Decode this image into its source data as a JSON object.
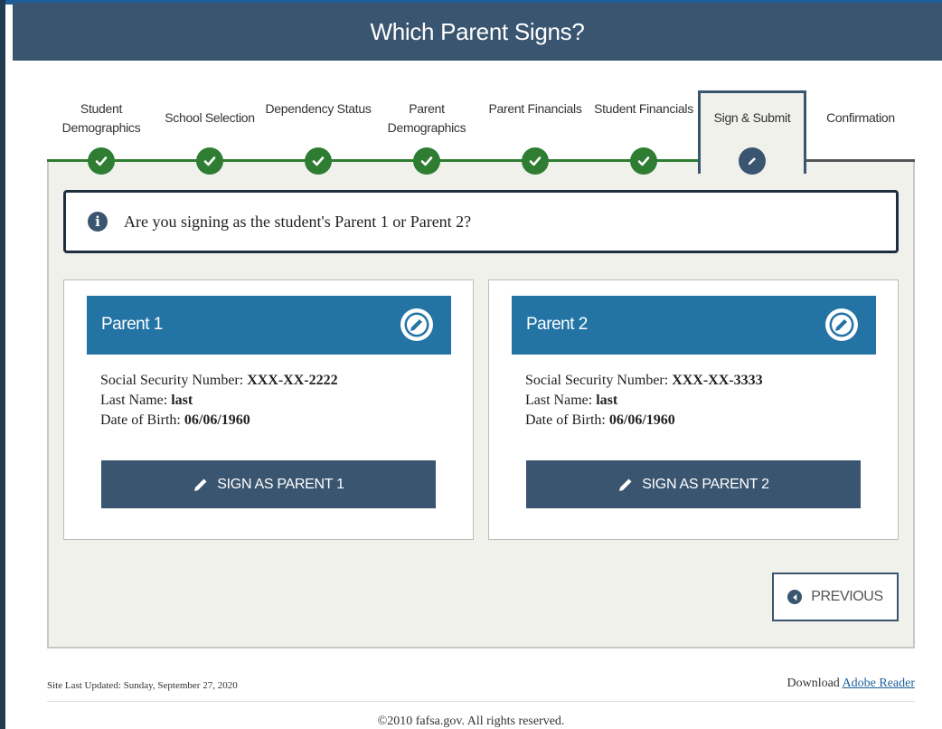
{
  "header": {
    "title": "Which Parent Signs?"
  },
  "steps": [
    {
      "label": "Student Demographics",
      "state": "complete"
    },
    {
      "label": "School Selection",
      "state": "complete"
    },
    {
      "label": "Dependency Status",
      "state": "complete"
    },
    {
      "label": "Parent Demographics",
      "state": "complete"
    },
    {
      "label": "Parent Financials",
      "state": "complete"
    },
    {
      "label": "Student Financials",
      "state": "complete"
    },
    {
      "label": "Sign & Submit",
      "state": "active"
    },
    {
      "label": "Confirmation",
      "state": "upcoming"
    }
  ],
  "info": {
    "text": "Are you signing as the student's Parent 1 or Parent 2?",
    "icon": "info-icon"
  },
  "parents": [
    {
      "title": "Parent 1",
      "ssn_label": "Social Security Number:",
      "ssn": "XXX-XX-2222",
      "lastname_label": "Last Name:",
      "lastname": "last",
      "dob_label": "Date of Birth:",
      "dob": "06/06/1960",
      "button": "SIGN AS PARENT 1"
    },
    {
      "title": "Parent 2",
      "ssn_label": "Social Security Number:",
      "ssn": "XXX-XX-3333",
      "lastname_label": "Last Name:",
      "lastname": "last",
      "dob_label": "Date of Birth:",
      "dob": "06/06/1960",
      "button": "SIGN AS PARENT 2"
    }
  ],
  "nav": {
    "previous": "PREVIOUS"
  },
  "footer": {
    "updated": "Site Last Updated: Sunday, September 27, 2020",
    "download_label": "Download",
    "download_link": "Adobe Reader",
    "copyright": "©2010 fafsa.gov. All rights reserved."
  },
  "colors": {
    "header": "#3a5570",
    "complete": "#2e7d32",
    "card_header": "#2473a5",
    "button": "#3a5570",
    "panel": "#f1f1ec"
  }
}
